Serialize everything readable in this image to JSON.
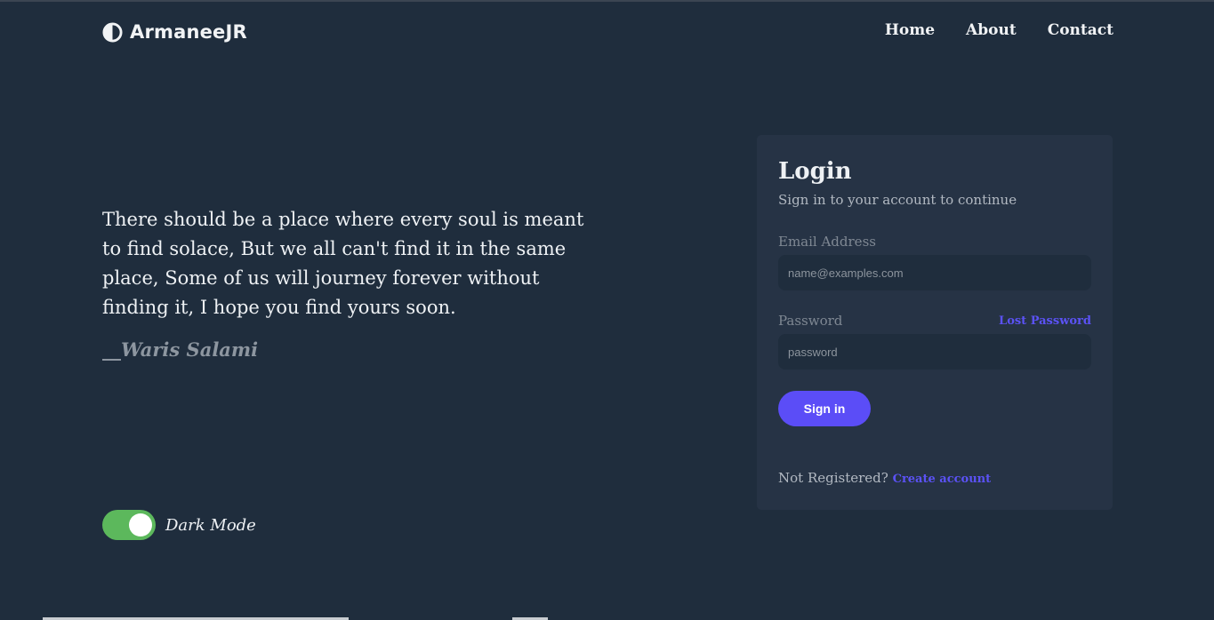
{
  "brand": {
    "name": "ArmaneeJR",
    "icon": "half-circle-logo-icon"
  },
  "nav": {
    "items": [
      {
        "label": "Home"
      },
      {
        "label": "About"
      },
      {
        "label": "Contact"
      }
    ]
  },
  "hero": {
    "quote": "There should be a place where every soul is meant to find solace, But we all can't find it in the same place, Some of us will journey forever without finding it, I hope you find yours soon.",
    "author": "__Waris Salami"
  },
  "dark_mode": {
    "label": "Dark Mode",
    "enabled": true,
    "toggle_color": "#5cb85c"
  },
  "login": {
    "title": "Login",
    "subtitle": "Sign in to your account to continue",
    "email_label": "Email Address",
    "email_placeholder": "name@examples.com",
    "email_value": "",
    "password_label": "Password",
    "password_placeholder": "password",
    "password_value": "",
    "lost_password": "Lost Password",
    "signin_label": "Sign in",
    "not_registered": "Not Registered?",
    "create_account": "Create account"
  },
  "colors": {
    "background": "#1f2d3d",
    "card": "#263345",
    "accent": "#5b4df7",
    "link": "#5b52f5"
  }
}
